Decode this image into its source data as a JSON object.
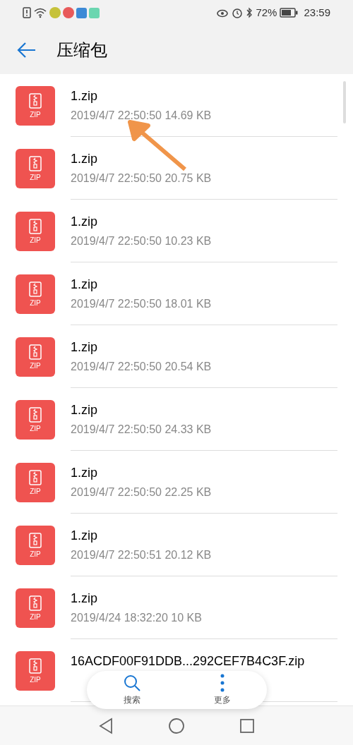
{
  "status_bar": {
    "battery_percent": "72%",
    "time": "23:59"
  },
  "header": {
    "title": "压缩包"
  },
  "files": [
    {
      "badge": "ZIP",
      "name": "1.zip",
      "meta": "2019/4/7 22:50:50 14.69 KB"
    },
    {
      "badge": "ZIP",
      "name": "1.zip",
      "meta": "2019/4/7 22:50:50 20.75 KB"
    },
    {
      "badge": "ZIP",
      "name": "1.zip",
      "meta": "2019/4/7 22:50:50 10.23 KB"
    },
    {
      "badge": "ZIP",
      "name": "1.zip",
      "meta": "2019/4/7 22:50:50 18.01 KB"
    },
    {
      "badge": "ZIP",
      "name": "1.zip",
      "meta": "2019/4/7 22:50:50 20.54 KB"
    },
    {
      "badge": "ZIP",
      "name": "1.zip",
      "meta": "2019/4/7 22:50:50 24.33 KB"
    },
    {
      "badge": "ZIP",
      "name": "1.zip",
      "meta": "2019/4/7 22:50:50 22.25 KB"
    },
    {
      "badge": "ZIP",
      "name": "1.zip",
      "meta": "2019/4/7 22:50:51 20.12 KB"
    },
    {
      "badge": "ZIP",
      "name": "1.zip",
      "meta": "2019/4/24 18:32:20 10 KB"
    },
    {
      "badge": "ZIP",
      "name": "16ACDF00F91DDB...292CEF7B4C3F.zip"
    }
  ],
  "floating_bar": [
    {
      "label": "搜索",
      "kind": "search"
    },
    {
      "label": "更多",
      "kind": "more"
    }
  ]
}
